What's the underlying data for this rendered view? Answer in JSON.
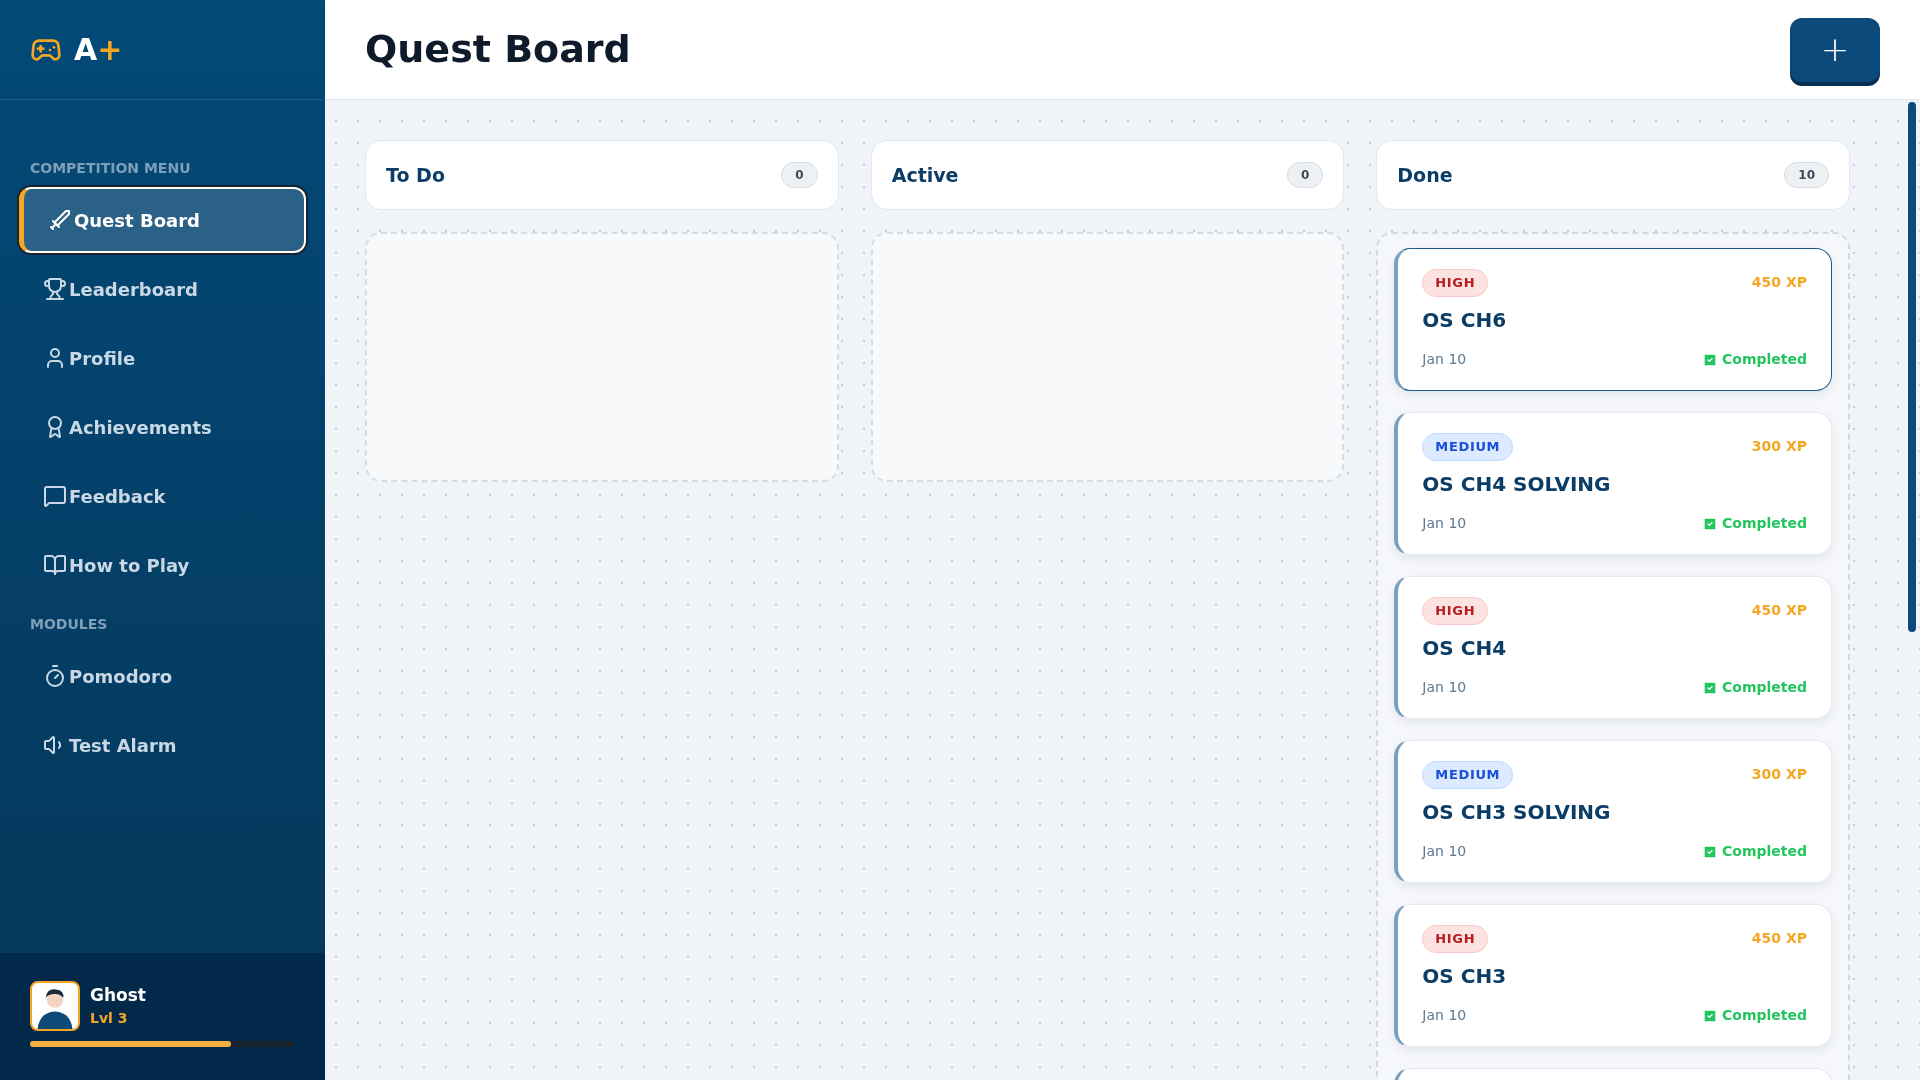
{
  "logo": {
    "text": "A",
    "accent": "+"
  },
  "sidebar": {
    "sections": [
      {
        "heading": "COMPETITION MENU",
        "items": [
          {
            "label": "Quest Board",
            "selected": true
          },
          {
            "label": "Leaderboard",
            "selected": false
          },
          {
            "label": "Profile",
            "selected": false
          },
          {
            "label": "Achievements",
            "selected": false
          },
          {
            "label": "Feedback",
            "selected": false
          },
          {
            "label": "How to Play",
            "selected": false
          }
        ]
      },
      {
        "heading": "MODULES",
        "items": [
          {
            "label": "Pomodoro",
            "selected": false
          },
          {
            "label": "Test Alarm",
            "selected": false
          }
        ]
      }
    ]
  },
  "user": {
    "name": "Ghost",
    "level_text": "Lvl 3",
    "level": 0.76
  },
  "page_title": "Quest Board",
  "add_button": "+",
  "columns": [
    {
      "title": "To Do",
      "count": "0"
    },
    {
      "title": "Active",
      "count": "0"
    },
    {
      "title": "Done",
      "count": "10",
      "cards": [
        {
          "priority": "HIGH",
          "kind": "high",
          "xp": "450 XP",
          "title": "OS CH6",
          "date": "Jan 10",
          "status": "Completed",
          "selected": true
        },
        {
          "priority": "MEDIUM",
          "kind": "medium",
          "xp": "300 XP",
          "title": "OS CH4 SOLVING",
          "date": "Jan 10",
          "status": "Completed",
          "selected": false
        },
        {
          "priority": "HIGH",
          "kind": "high",
          "xp": "450 XP",
          "title": "OS CH4",
          "date": "Jan 10",
          "status": "Completed",
          "selected": false
        },
        {
          "priority": "MEDIUM",
          "kind": "medium",
          "xp": "300 XP",
          "title": "OS CH3 SOLVING",
          "date": "Jan 10",
          "status": "Completed",
          "selected": false
        },
        {
          "priority": "HIGH",
          "kind": "high",
          "xp": "450 XP",
          "title": "OS CH3",
          "date": "Jan 10",
          "status": "Completed",
          "selected": false
        },
        {
          "kind": "partial"
        }
      ]
    }
  ]
}
